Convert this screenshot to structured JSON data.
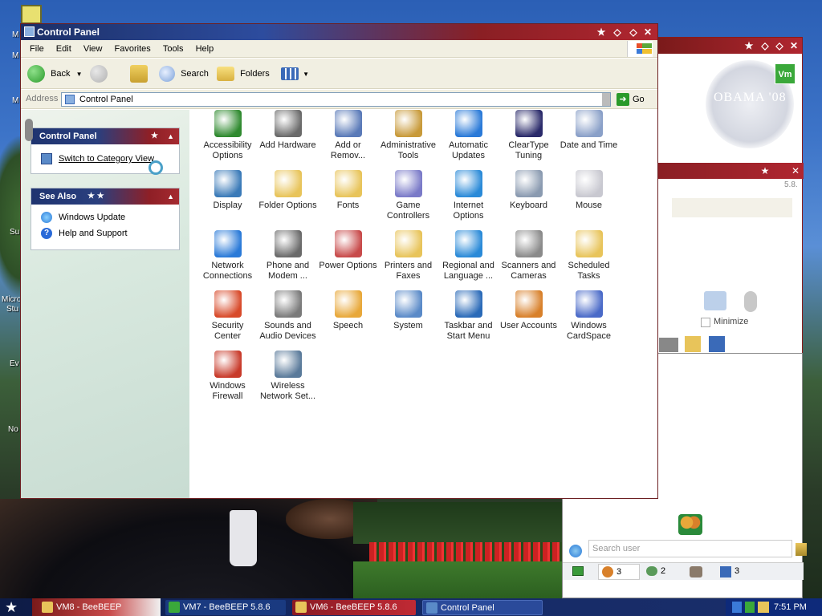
{
  "desktop": {
    "labels": [
      "M",
      "M",
      "M",
      "Su",
      "Micro",
      "Stu",
      "Ev",
      "No"
    ]
  },
  "control_panel": {
    "title": "Control Panel",
    "menu": [
      "File",
      "Edit",
      "View",
      "Favorites",
      "Tools",
      "Help"
    ],
    "toolbar": {
      "back": "Back",
      "search": "Search",
      "folders": "Folders"
    },
    "address": {
      "label": "Address",
      "value": "Control Panel",
      "go": "Go"
    },
    "left_panels": {
      "control_panel_header": "Control Panel",
      "switch_view": "Switch to Category View",
      "see_also_header": "See Also",
      "see_also_items": [
        "Windows Update",
        "Help and Support"
      ]
    },
    "items": [
      {
        "label": "Accessibility Options",
        "icon": "accessibility-icon",
        "color": "#2f8a2f"
      },
      {
        "label": "Add Hardware",
        "icon": "hardware-icon",
        "color": "#6a6a6a"
      },
      {
        "label": "Add or Remov...",
        "icon": "add-remove-icon",
        "color": "#5a7ab8"
      },
      {
        "label": "Administrative Tools",
        "icon": "admin-tools-icon",
        "color": "#c89a3a"
      },
      {
        "label": "Automatic Updates",
        "icon": "windows-update-icon",
        "color": "#2a7ad8"
      },
      {
        "label": "ClearType Tuning",
        "icon": "cleartype-icon",
        "color": "#2a2a6a"
      },
      {
        "label": "Date and Time",
        "icon": "clock-icon",
        "color": "#8aa0c8"
      },
      {
        "label": "Display",
        "icon": "display-icon",
        "color": "#3a7ab8"
      },
      {
        "label": "Folder Options",
        "icon": "folder-options-icon",
        "color": "#e8c45a"
      },
      {
        "label": "Fonts",
        "icon": "fonts-icon",
        "color": "#e8c45a"
      },
      {
        "label": "Game Controllers",
        "icon": "gamepad-icon",
        "color": "#7a7ac8"
      },
      {
        "label": "Internet Options",
        "icon": "internet-options-icon",
        "color": "#2a8ad8"
      },
      {
        "label": "Keyboard",
        "icon": "keyboard-icon",
        "color": "#8a9ab0"
      },
      {
        "label": "Mouse",
        "icon": "mouse-icon",
        "color": "#c8c8d0"
      },
      {
        "label": "Network Connections",
        "icon": "network-icon",
        "color": "#2a7ad8"
      },
      {
        "label": "Phone and Modem ...",
        "icon": "phone-icon",
        "color": "#6a6a6a"
      },
      {
        "label": "Power Options",
        "icon": "power-icon",
        "color": "#c84a4a"
      },
      {
        "label": "Printers and Faxes",
        "icon": "printer-icon",
        "color": "#e8c45a"
      },
      {
        "label": "Regional and Language ...",
        "icon": "globe-icon",
        "color": "#2a8ad8"
      },
      {
        "label": "Scanners and Cameras",
        "icon": "scanner-icon",
        "color": "#8a8a8a"
      },
      {
        "label": "Scheduled Tasks",
        "icon": "scheduled-tasks-icon",
        "color": "#e8c45a"
      },
      {
        "label": "Security Center",
        "icon": "shield-icon",
        "color": "#d84a2a"
      },
      {
        "label": "Sounds and Audio Devices",
        "icon": "speaker-icon",
        "color": "#7a7a7a"
      },
      {
        "label": "Speech",
        "icon": "speech-icon",
        "color": "#e8a83a"
      },
      {
        "label": "System",
        "icon": "system-icon",
        "color": "#5a8ac8"
      },
      {
        "label": "Taskbar and Start Menu",
        "icon": "taskbar-icon",
        "color": "#2a6ab8"
      },
      {
        "label": "User Accounts",
        "icon": "user-accounts-icon",
        "color": "#d8802a"
      },
      {
        "label": "Windows CardSpace",
        "icon": "cardspace-icon",
        "color": "#4a6ac8"
      },
      {
        "label": "Windows Firewall",
        "icon": "firewall-icon",
        "color": "#c83a2a"
      },
      {
        "label": "Wireless Network Set...",
        "icon": "wireless-icon",
        "color": "#5a7a9a"
      }
    ]
  },
  "beebeep": {
    "vm_badge": "Vm",
    "minimize_label": "Minimize",
    "number_fragment": "5.8.",
    "search_placeholder": "Search user",
    "status_counts": [
      "3",
      "2",
      "3"
    ],
    "watermark": "OBAMA '08"
  },
  "taskbar": {
    "tasks": [
      {
        "label": "VM8 - BeeBEEP",
        "icon": "beebeep-icon",
        "color": "#e8c45a"
      },
      {
        "label": "VM7 - BeeBEEP 5.8.6",
        "icon": "vm-icon",
        "color": "#3aa83a"
      },
      {
        "label": "VM6 - BeeBEEP 5.8.6",
        "icon": "beebeep-icon",
        "color": "#e8c45a"
      },
      {
        "label": "Control Panel",
        "icon": "control-panel-icon",
        "color": "#5a8ac8"
      }
    ],
    "clock": "7:51 PM"
  }
}
